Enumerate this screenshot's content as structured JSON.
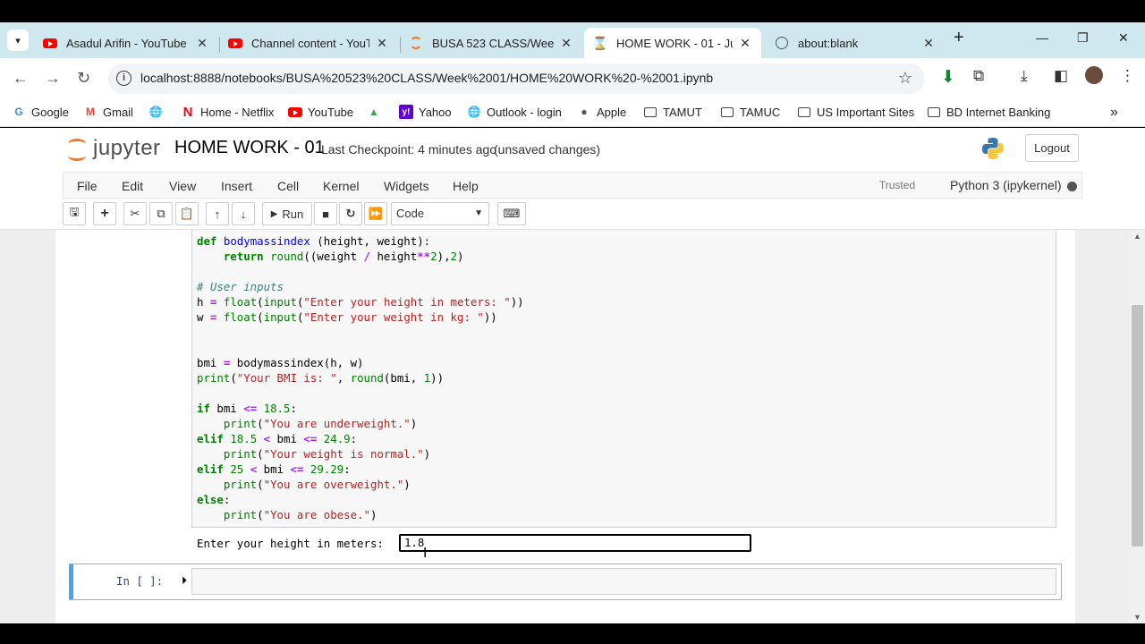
{
  "browser": {
    "tabs": [
      {
        "title": "Asadul Arifin - YouTube",
        "icon": "youtube-icon"
      },
      {
        "title": "Channel content - YouTube",
        "icon": "youtube-icon"
      },
      {
        "title": "BUSA 523 CLASS/Week 01",
        "icon": "jupyter-icon"
      },
      {
        "title": "HOME WORK - 01 - Jupyter",
        "icon": "hourglass-icon",
        "active": true
      },
      {
        "title": "about:blank",
        "icon": "globe-icon"
      }
    ],
    "url": "localhost:8888/notebooks/BUSA%20523%20CLASS/Week%2001/HOME%20WORK%20-%2001.ipynb",
    "bookmarks": [
      {
        "label": "Google",
        "icon": "google-icon"
      },
      {
        "label": "Gmail",
        "icon": "gmail-icon"
      },
      {
        "label": "",
        "icon": "globe-icon"
      },
      {
        "label": "Home - Netflix",
        "icon": "netflix-icon"
      },
      {
        "label": "YouTube",
        "icon": "youtube-icon"
      },
      {
        "label": "",
        "icon": "drive-icon"
      },
      {
        "label": "Yahoo",
        "icon": "yahoo-icon"
      },
      {
        "label": "Outlook - login",
        "icon": "globe-icon"
      },
      {
        "label": "Apple",
        "icon": "apple-icon"
      },
      {
        "label": "TAMUT",
        "icon": "folder-icon"
      },
      {
        "label": "TAMUC",
        "icon": "folder-icon"
      },
      {
        "label": "US Important Sites",
        "icon": "folder-icon"
      },
      {
        "label": "BD Internet Banking",
        "icon": "folder-icon"
      }
    ]
  },
  "jupyter": {
    "logo_text": "jupyter",
    "notebook_name": "HOME WORK - 01",
    "checkpoint": "Last Checkpoint: 4 minutes ago",
    "save_status": "(unsaved changes)",
    "logout_label": "Logout",
    "menus": [
      "File",
      "Edit",
      "View",
      "Insert",
      "Cell",
      "Kernel",
      "Widgets",
      "Help"
    ],
    "trusted_label": "Trusted",
    "kernel_name": "Python 3 (ipykernel)",
    "run_label": "Run",
    "cell_type": "Code",
    "input_prompt_label": "Enter your height in meters:",
    "input_value": "1.8",
    "empty_cell_prompt": "In [ ]:"
  }
}
